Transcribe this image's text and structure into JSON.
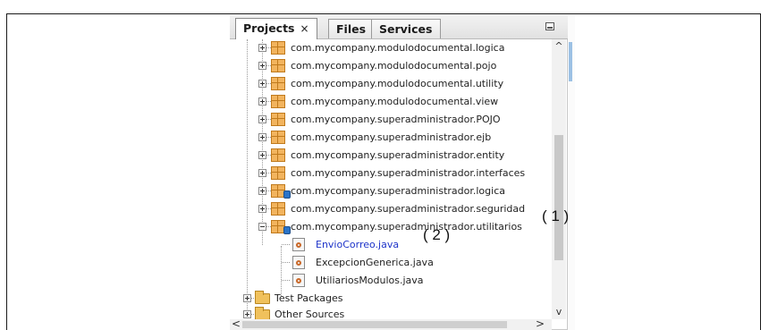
{
  "tabs": [
    {
      "label": "Projects",
      "close": "×",
      "active": true
    },
    {
      "label": "Files",
      "active": false
    },
    {
      "label": "Services",
      "active": false
    }
  ],
  "tree": {
    "packages": [
      "com.mycompany.modulodocumental.logica",
      "com.mycompany.modulodocumental.pojo",
      "com.mycompany.modulodocumental.utility",
      "com.mycompany.modulodocumental.view",
      "com.mycompany.superadministrador.POJO",
      "com.mycompany.superadministrador.ejb",
      "com.mycompany.superadministrador.entity",
      "com.mycompany.superadministrador.interfaces",
      "com.mycompany.superadministrador.logica",
      "com.mycompany.superadministrador.seguridad",
      "com.mycompany.superadministrador.utilitarios"
    ],
    "files": [
      "EnvioCorreo.java",
      "ExcepcionGenerica.java",
      "UtiliariosModulos.java"
    ],
    "folders": [
      "Test Packages",
      "Other Sources"
    ]
  },
  "annotations": {
    "first": "( 1 )",
    "second": "( 2 )"
  },
  "scroll": {
    "up": "^",
    "down": "v",
    "left": "<",
    "right": ">"
  }
}
